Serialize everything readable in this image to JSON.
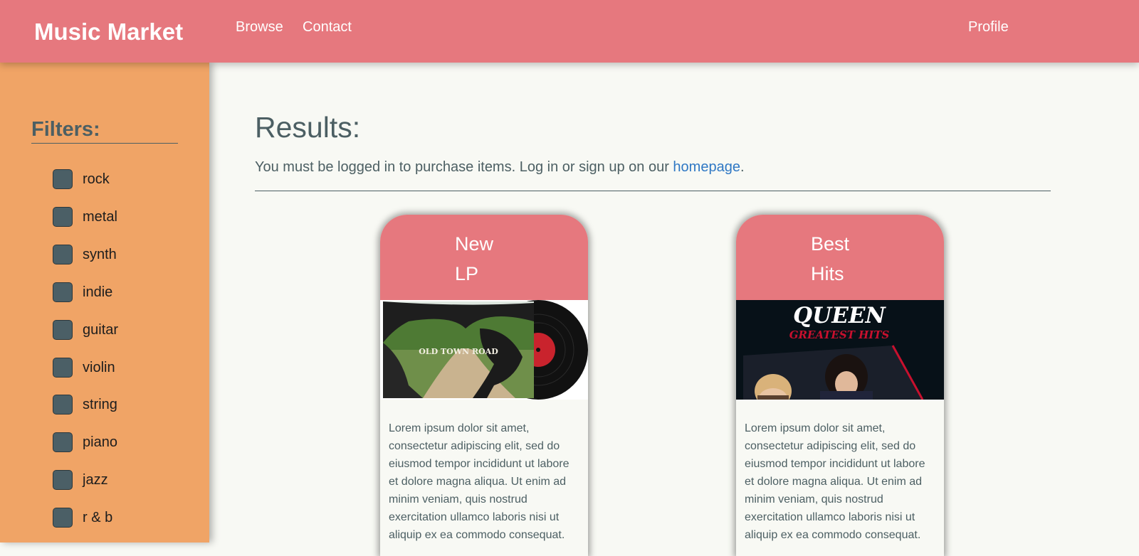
{
  "navbar": {
    "brand": "Music Market",
    "links": [
      "Browse",
      "Contact"
    ],
    "profile": "Profile"
  },
  "sidebar": {
    "title": "Filters:",
    "filters": [
      "rock",
      "metal",
      "synth",
      "indie",
      "guitar",
      "violin",
      "string",
      "piano",
      "jazz",
      "r & b"
    ]
  },
  "main": {
    "title": "Results:",
    "notice_text": "You must be logged in to purchase items. Log in or sign up on our ",
    "notice_link": "homepage",
    "notice_end": ".",
    "cards": [
      {
        "title_line1": "New",
        "title_line2": "LP",
        "image_caption": "OLD TOWN ROAD",
        "text": "Lorem ipsum dolor sit amet, consectetur adipiscing elit, sed do eiusmod tempor incididunt ut labore et dolore magna aliqua. Ut enim ad minim veniam, quis nostrud exercitation ullamco laboris nisi ut aliquip ex ea commodo consequat."
      },
      {
        "title_line1": "Best",
        "title_line2": "Hits",
        "image_title": "QUEEN",
        "image_subtitle": "GREATEST HITS",
        "text": "Lorem ipsum dolor sit amet, consectetur adipiscing elit, sed do eiusmod tempor incididunt ut labore et dolore magna aliqua. Ut enim ad minim veniam, quis nostrud exercitation ullamco laboris nisi ut aliquip ex ea commodo consequat."
      }
    ]
  },
  "colors": {
    "navbar": "#e6787e",
    "sidebar": "#f0a466",
    "text": "#4c5f63",
    "link": "#2f78c4",
    "checkbox": "#4b5f66"
  }
}
